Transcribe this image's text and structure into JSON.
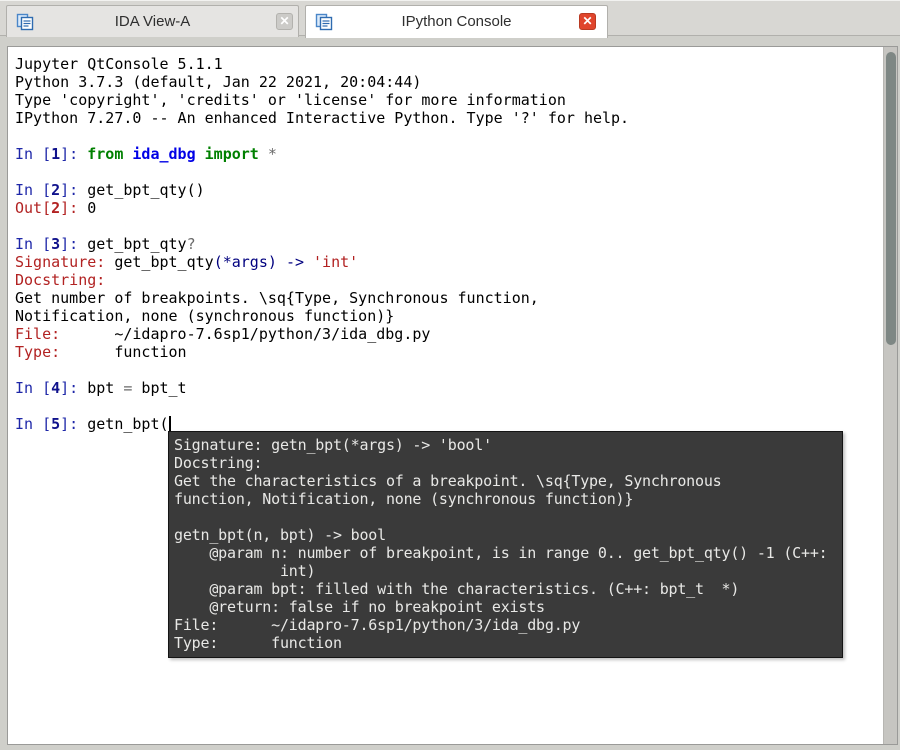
{
  "tab_bar": {
    "tabs": [
      {
        "label": "IDA View-A",
        "active": false
      },
      {
        "label": "IPython Console",
        "active": true
      }
    ]
  },
  "colors": {
    "active_tab_close": "#e0452c",
    "inactive_tab_close": "#cccbc8",
    "prompt_in_blue": "#1e27a8",
    "prompt_out_red": "#b22222",
    "keyword_green": "#008000",
    "name_blue": "#0000e6",
    "operator_gray": "#6a6a6a",
    "string_red": "#b22121",
    "tooltip_bg": "#3a3a3a",
    "tooltip_text": "#e8e8e6"
  },
  "console": {
    "lines": [
      {
        "segments": [
          {
            "t": "Jupyter QtConsole 5.1.1",
            "c": "plain"
          }
        ]
      },
      {
        "segments": [
          {
            "t": "Python 3.7.3 (default, Jan 22 2021, 20:04:44)",
            "c": "plain"
          }
        ]
      },
      {
        "segments": [
          {
            "t": "Type 'copyright', 'credits' or 'license' for more information",
            "c": "plain"
          }
        ]
      },
      {
        "segments": [
          {
            "t": "IPython 7.27.0 -- An enhanced Interactive Python. Type '?' for help.",
            "c": "plain"
          }
        ]
      },
      {
        "segments": []
      },
      {
        "segments": [
          {
            "t": "In [",
            "c": "in"
          },
          {
            "t": "1",
            "c": "inb"
          },
          {
            "t": "]: ",
            "c": "in"
          },
          {
            "t": "from",
            "c": "kw"
          },
          {
            "t": " ",
            "c": "plain"
          },
          {
            "t": "ida_dbg",
            "c": "nm"
          },
          {
            "t": " ",
            "c": "plain"
          },
          {
            "t": "import",
            "c": "kw"
          },
          {
            "t": " ",
            "c": "plain"
          },
          {
            "t": "*",
            "c": "op"
          }
        ]
      },
      {
        "segments": []
      },
      {
        "segments": [
          {
            "t": "In [",
            "c": "in"
          },
          {
            "t": "2",
            "c": "inb"
          },
          {
            "t": "]: ",
            "c": "in"
          },
          {
            "t": "get_bpt_qty()",
            "c": "plain"
          }
        ]
      },
      {
        "segments": [
          {
            "t": "Out[",
            "c": "out"
          },
          {
            "t": "2",
            "c": "outb"
          },
          {
            "t": "]: ",
            "c": "out"
          },
          {
            "t": "0",
            "c": "plain"
          }
        ]
      },
      {
        "segments": []
      },
      {
        "segments": [
          {
            "t": "In [",
            "c": "in"
          },
          {
            "t": "3",
            "c": "inb"
          },
          {
            "t": "]: ",
            "c": "in"
          },
          {
            "t": "get_bpt_qty",
            "c": "plain"
          },
          {
            "t": "?",
            "c": "op"
          }
        ]
      },
      {
        "segments": [
          {
            "t": "Signature: ",
            "c": "out"
          },
          {
            "t": "get_bpt_qty",
            "c": "plain"
          },
          {
            "t": "(*args)",
            "c": "nav"
          },
          {
            "t": " ",
            "c": "plain"
          },
          {
            "t": "->",
            "c": "nav"
          },
          {
            "t": " ",
            "c": "plain"
          },
          {
            "t": "'int'",
            "c": "str"
          }
        ]
      },
      {
        "segments": [
          {
            "t": "Docstring:",
            "c": "out"
          }
        ]
      },
      {
        "segments": [
          {
            "t": "Get number of breakpoints. \\sq{Type, Synchronous function,",
            "c": "plain"
          }
        ]
      },
      {
        "segments": [
          {
            "t": "Notification, none (synchronous function)}",
            "c": "plain"
          }
        ]
      },
      {
        "segments": [
          {
            "t": "File:",
            "c": "out"
          },
          {
            "t": "      ~/idapro-7.6sp1/python/3/ida_dbg.py",
            "c": "plain"
          }
        ]
      },
      {
        "segments": [
          {
            "t": "Type:",
            "c": "out"
          },
          {
            "t": "      function",
            "c": "plain"
          }
        ]
      },
      {
        "segments": []
      },
      {
        "segments": [
          {
            "t": "In [",
            "c": "in"
          },
          {
            "t": "4",
            "c": "inb"
          },
          {
            "t": "]: ",
            "c": "in"
          },
          {
            "t": "bpt ",
            "c": "plain"
          },
          {
            "t": "=",
            "c": "op"
          },
          {
            "t": " bpt_t",
            "c": "plain"
          }
        ]
      },
      {
        "segments": []
      },
      {
        "segments": [
          {
            "t": "In [",
            "c": "in"
          },
          {
            "t": "5",
            "c": "inb"
          },
          {
            "t": "]: ",
            "c": "in"
          },
          {
            "t": "getn_bpt(",
            "c": "plain"
          }
        ],
        "cursor": true
      }
    ]
  },
  "tooltip": {
    "lines": [
      "Signature: getn_bpt(*args) -> 'bool'",
      "Docstring:",
      "Get the characteristics of a breakpoint. \\sq{Type, Synchronous",
      "function, Notification, none (synchronous function)}",
      "",
      "getn_bpt(n, bpt) -> bool",
      "    @param n: number of breakpoint, is in range 0.. get_bpt_qty() -1 (C++:",
      "            int)",
      "    @param bpt: filled with the characteristics. (C++: bpt_t  *)",
      "    @return: false if no breakpoint exists",
      "File:      ~/idapro-7.6sp1/python/3/ida_dbg.py",
      "Type:      function"
    ]
  }
}
